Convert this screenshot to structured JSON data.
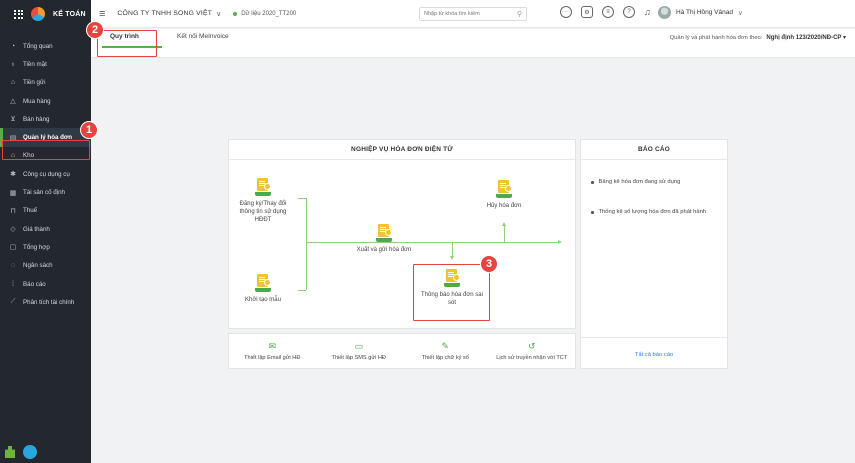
{
  "sidebar": {
    "logo_text": "KẾ TOÁN",
    "items": [
      {
        "label": "Tổng quan",
        "icon": "dashboard-icon"
      },
      {
        "label": "Tiền mặt",
        "icon": "cash-icon"
      },
      {
        "label": "Tiền gửi",
        "icon": "bank-icon"
      },
      {
        "label": "Mua hàng",
        "icon": "purchase-icon"
      },
      {
        "label": "Bán hàng",
        "icon": "cart-icon"
      },
      {
        "label": "Quản lý hóa đơn",
        "icon": "invoice-icon",
        "active": true
      },
      {
        "label": "Kho",
        "icon": "warehouse-icon"
      },
      {
        "label": "Công cụ dụng cụ",
        "icon": "tools-icon"
      },
      {
        "label": "Tài sản cố định",
        "icon": "asset-icon"
      },
      {
        "label": "Thuế",
        "icon": "tax-icon"
      },
      {
        "label": "Giá thành",
        "icon": "cost-icon"
      },
      {
        "label": "Tổng hợp",
        "icon": "summary-icon"
      },
      {
        "label": "Ngân sách",
        "icon": "budget-icon"
      },
      {
        "label": "Báo cáo",
        "icon": "report-icon"
      },
      {
        "label": "Phân tích tài chính",
        "icon": "analysis-icon"
      }
    ]
  },
  "header": {
    "company": "CÔNG TY TNHH SONG VIỆT",
    "data_label": "Dữ liệu 2020_TT200",
    "search_placeholder": "Nhập từ khóa tìm kiếm",
    "user_name": "Hà Thị Hồng Vânad"
  },
  "tabs": {
    "process": "Quy trình",
    "meinvoice": "Kết nối MeInvoice",
    "decree_label": "Quản lý và phát hành hóa đơn theo:",
    "decree_value": "Nghị định 123/2020/NĐ-CP ▾"
  },
  "callouts": {
    "one": "1",
    "two": "2",
    "three": "3"
  },
  "process": {
    "title": "NGHIỆP VỤ HÓA ĐƠN ĐIỆN TỬ",
    "register": "Đăng ký/Thay đổi thông tin sử dụng HĐĐT",
    "template": "Khởi tạo mẫu",
    "issue": "Xuất và gửi hóa đơn",
    "cancel": "Hủy hóa đơn",
    "error_notice": "Thông báo hóa đơn sai sót"
  },
  "report": {
    "title": "BÁO CÁO",
    "items": [
      "Bảng kê hóa đơn đang sử dụng",
      "Thống kê số lượng hóa đơn đã phát hành"
    ],
    "all": "Tất cả báo cáo"
  },
  "tools": [
    {
      "label": "Thiết lập Email gửi HĐ",
      "icon": "email-icon"
    },
    {
      "label": "Thiết lập SMS gửi HĐ",
      "icon": "sms-icon"
    },
    {
      "label": "Thiết lập chữ ký số",
      "icon": "signature-icon"
    },
    {
      "label": "Lịch sử truyền nhận với TCT",
      "icon": "history-icon"
    }
  ]
}
